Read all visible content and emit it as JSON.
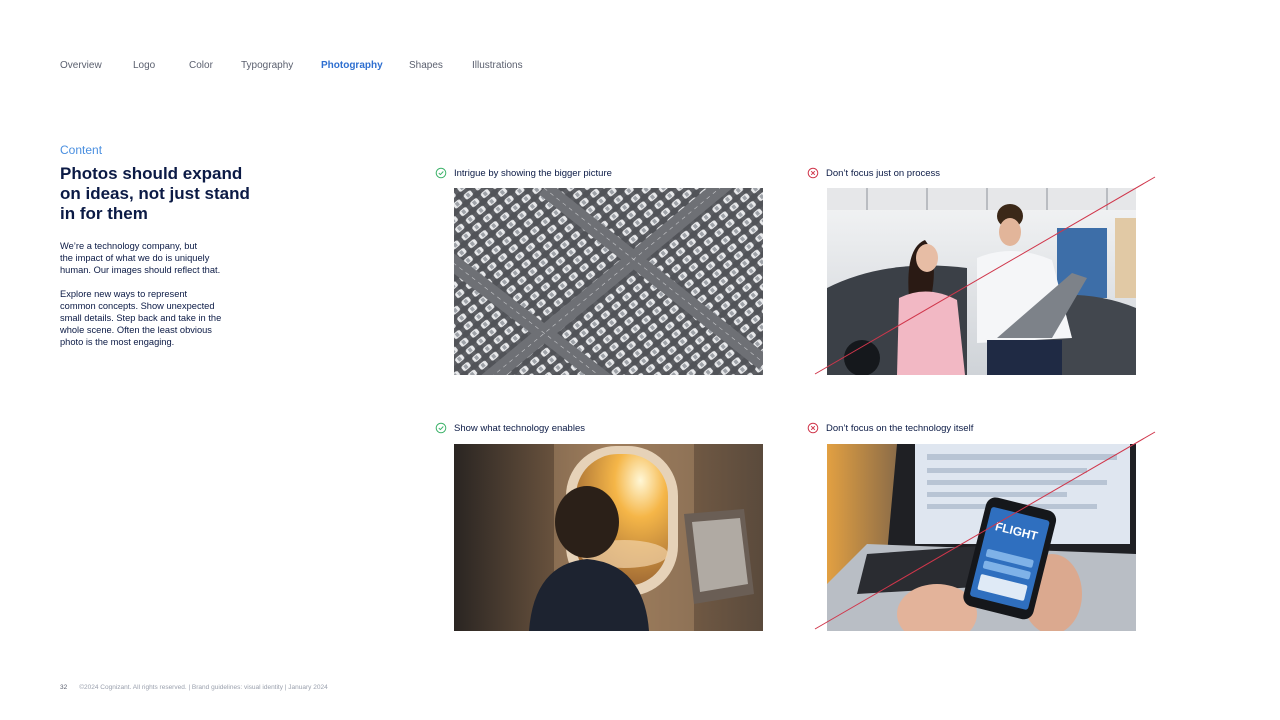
{
  "nav": {
    "items": [
      "Overview",
      "Logo",
      "Color",
      "Typography",
      "Photography",
      "Shapes",
      "Illustrations"
    ],
    "active": "Photography"
  },
  "content": {
    "eyebrow": "Content",
    "title": "Photos should expand on ideas, not just stand in for them",
    "para1": "We’re a technology company, but\nthe impact of what we do is uniquely\nhuman. Our images should reflect that.",
    "para2": "Explore new ways to represent\ncommon concepts. Show unexpected\nsmall details. Step back and take in the\nwhole scene. Often the least obvious\nphoto is the most engaging."
  },
  "examples": [
    {
      "caption": "Intrigue by showing the bigger picture",
      "verdict": "do",
      "image": "aerial-parking-lot-photo"
    },
    {
      "caption": "Don’t focus just on process",
      "verdict": "dont",
      "image": "two-people-with-laptop-photo"
    },
    {
      "caption": "Show what technology enables",
      "verdict": "do",
      "image": "child-airplane-window-photo"
    },
    {
      "caption": "Don’t focus on the technology itself",
      "verdict": "dont",
      "image": "phone-flight-app-photo"
    }
  ],
  "phone_screen_text": "FLIGHT",
  "colors": {
    "do": "#3fb36b",
    "dont": "#d0364b",
    "accent": "#2e6fd0",
    "navy": "#0b1a45"
  },
  "footer": {
    "page_number": "32",
    "text": "©2024 Cognizant. All rights reserved.  |  Brand guidelines: visual identity  |  January 2024"
  }
}
